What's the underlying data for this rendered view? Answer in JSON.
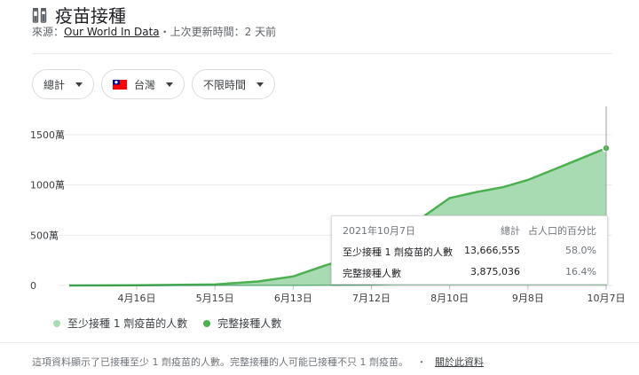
{
  "header": {
    "title": "疫苗接種"
  },
  "source": {
    "prefix": "來源：",
    "link": "Our World In Data",
    "updated": "・上次更新時間：2 天前"
  },
  "filters": {
    "total": "總計",
    "region": "台灣",
    "time": "不限時間"
  },
  "colors": {
    "fill": "#a8dbb1",
    "line": "#4caf50",
    "second": "#2e8b57"
  },
  "chart_data": {
    "type": "area",
    "x_tick_labels": [
      "4月16日",
      "5月15日",
      "6月13日",
      "7月12日",
      "8月10日",
      "9月8日",
      "10月7日"
    ],
    "y_tick_labels": [
      "0",
      "500萬",
      "1000萬",
      "1500萬"
    ],
    "ylim": [
      0,
      15000000
    ],
    "series": [
      {
        "name": "至少接種 1 劑疫苗的人數",
        "x": [
          "3月22日",
          "4月16日",
          "5月15日",
          "5月31日",
          "6月13日",
          "6月25日",
          "7月5日",
          "7月12日",
          "7月20日",
          "8月1日",
          "8月10日",
          "8月20日",
          "8月30日",
          "9月8日",
          "9月20日",
          "9月30日",
          "10月7日"
        ],
        "values": [
          0,
          20000,
          100000,
          400000,
          900000,
          2000000,
          2800000,
          3300000,
          4100000,
          7000000,
          8700000,
          9300000,
          9800000,
          10500000,
          11800000,
          12900000,
          13666555
        ]
      },
      {
        "name": "完整接種人數",
        "x": [
          "3月22日",
          "6月13日",
          "7月12日",
          "8月10日",
          "9月8日",
          "10月7日"
        ],
        "values": [
          0,
          10000,
          50000,
          400000,
          1000000,
          3875036
        ]
      }
    ]
  },
  "tooltip": {
    "date": "2021年10月7日",
    "col_total": "總計",
    "col_pct": "占人口的百分比",
    "rows": [
      {
        "label": "至少接種 1 劑疫苗的人數",
        "value": "13,666,555",
        "pct": "58.0%"
      },
      {
        "label": "完整接種人數",
        "value": "3,875,036",
        "pct": "16.4%"
      }
    ]
  },
  "legend": {
    "first": "至少接種 1 劑疫苗的人數",
    "second": "完整接種人數"
  },
  "footer": {
    "note": "這項資料顯示了已接種至少 1 劑疫苗的人數。完整接種的人可能已接種不只 1 劑疫苗。",
    "sep": "・",
    "link": "關於此資料"
  }
}
